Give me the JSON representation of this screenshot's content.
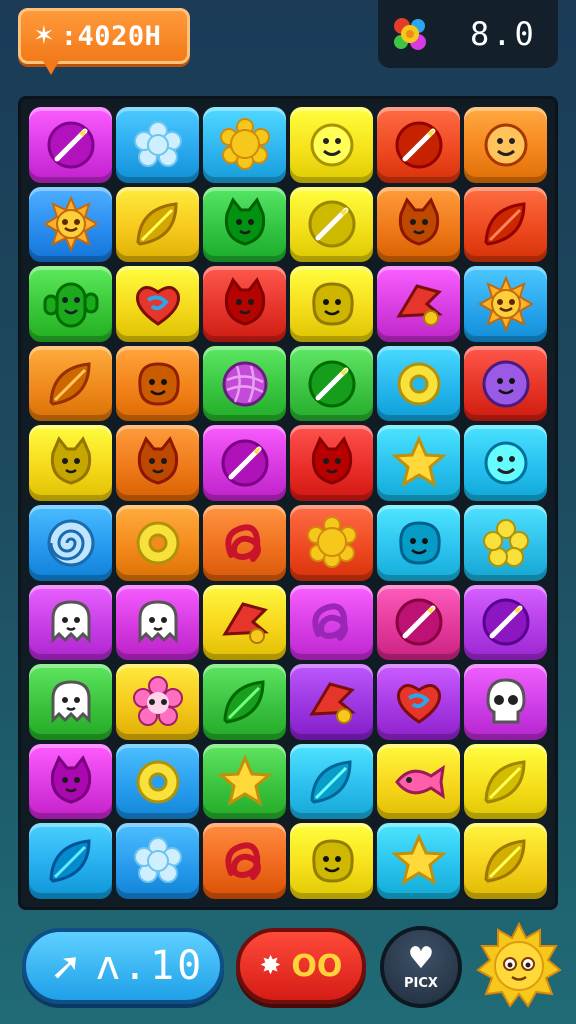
{
  "hud": {
    "score_icon": "star-sparkle-icon",
    "score_text": ":4020H",
    "moves_icon": "flower-cluster-icon",
    "moves_value": "8.0"
  },
  "board": {
    "columns": 6,
    "rows": 10,
    "tiles": [
      [
        {
          "color": "#d93ae6",
          "icon": "feather-ball"
        },
        {
          "color": "#2aa9ef",
          "icon": "snowflake"
        },
        {
          "color": "#2fb6f0",
          "icon": "sun-flower"
        },
        {
          "color": "#f6e31c",
          "icon": "face"
        },
        {
          "color": "#ef4a22",
          "icon": "feather-ball"
        },
        {
          "color": "#f5871e",
          "icon": "face"
        }
      ],
      [
        {
          "color": "#2b8df0",
          "icon": "sun"
        },
        {
          "color": "#f7c91c",
          "icon": "leaf"
        },
        {
          "color": "#33c444",
          "icon": "cat"
        },
        {
          "color": "#f4e11c",
          "icon": "feather-ball"
        },
        {
          "color": "#f07a1a",
          "icon": "cat"
        },
        {
          "color": "#ee4a1f",
          "icon": "leaf"
        }
      ],
      [
        {
          "color": "#3ac73a",
          "icon": "cactus-face"
        },
        {
          "color": "#f5da1c",
          "icon": "heart-swirl"
        },
        {
          "color": "#e6352b",
          "icon": "cat"
        },
        {
          "color": "#f6dd1c",
          "icon": "blob-face"
        },
        {
          "color": "#d83ee2",
          "icon": "flag"
        },
        {
          "color": "#2aa6ef",
          "icon": "sun"
        }
      ],
      [
        {
          "color": "#f08a1c",
          "icon": "leaf"
        },
        {
          "color": "#f3831a",
          "icon": "blob-face"
        },
        {
          "color": "#3ac640",
          "icon": "yarn"
        },
        {
          "color": "#3ec544",
          "icon": "feather-ball"
        },
        {
          "color": "#27b7ef",
          "icon": "donut"
        },
        {
          "color": "#e63527",
          "icon": "sun-face"
        }
      ],
      [
        {
          "color": "#f7d91c",
          "icon": "cat"
        },
        {
          "color": "#f07a1a",
          "icon": "cat"
        },
        {
          "color": "#d63ae0",
          "icon": "feather-ball"
        },
        {
          "color": "#ea2f2b",
          "icon": "cat"
        },
        {
          "color": "#2ac2ee",
          "icon": "star"
        },
        {
          "color": "#28c0ee",
          "icon": "face"
        }
      ],
      [
        {
          "color": "#279aef",
          "icon": "swirl"
        },
        {
          "color": "#f58a1c",
          "icon": "donut"
        },
        {
          "color": "#f07220",
          "icon": "knot"
        },
        {
          "color": "#ef4a22",
          "icon": "sun-flower"
        },
        {
          "color": "#2dc4f0",
          "icon": "blob-face"
        },
        {
          "color": "#2dbfe9",
          "icon": "star-flower"
        }
      ],
      [
        {
          "color": "#c73ee6",
          "icon": "ghost"
        },
        {
          "color": "#d43ae0",
          "icon": "ghost"
        },
        {
          "color": "#f7d61c",
          "icon": "flag"
        },
        {
          "color": "#d63ee6",
          "icon": "knot"
        },
        {
          "color": "#e33a9b",
          "icon": "feather-ball"
        },
        {
          "color": "#b43ee8",
          "icon": "feather-ball"
        }
      ],
      [
        {
          "color": "#3cc33e",
          "icon": "ghost"
        },
        {
          "color": "#f7c81c",
          "icon": "flower"
        },
        {
          "color": "#3ac240",
          "icon": "leaf"
        },
        {
          "color": "#9b36e0",
          "icon": "flag"
        },
        {
          "color": "#a83ae6",
          "icon": "heart-swirl"
        },
        {
          "color": "#ce3ee6",
          "icon": "skull"
        }
      ],
      [
        {
          "color": "#dd3ae3",
          "icon": "cat"
        },
        {
          "color": "#2a9eef",
          "icon": "donut"
        },
        {
          "color": "#3cc440",
          "icon": "star"
        },
        {
          "color": "#2dc0ef",
          "icon": "leaf"
        },
        {
          "color": "#f7d61c",
          "icon": "fish"
        },
        {
          "color": "#f7df1c",
          "icon": "leaf"
        }
      ],
      [
        {
          "color": "#27aeef",
          "icon": "leaf"
        },
        {
          "color": "#2a9cef",
          "icon": "snowflake"
        },
        {
          "color": "#f06a1e",
          "icon": "knot"
        },
        {
          "color": "#f7e11c",
          "icon": "blob-face"
        },
        {
          "color": "#2ac3ee",
          "icon": "star"
        },
        {
          "color": "#f7d21c",
          "icon": "leaf"
        }
      ]
    ]
  },
  "bottom": {
    "level_icon": "arrow-hand-icon",
    "level_value": "ʌ.10",
    "boost_icon": "sparkle-icon",
    "boost_value": "OO",
    "pick_icon": "heart-icon",
    "pick_label": "PICX",
    "sun_icon": "sun-face-icon"
  }
}
